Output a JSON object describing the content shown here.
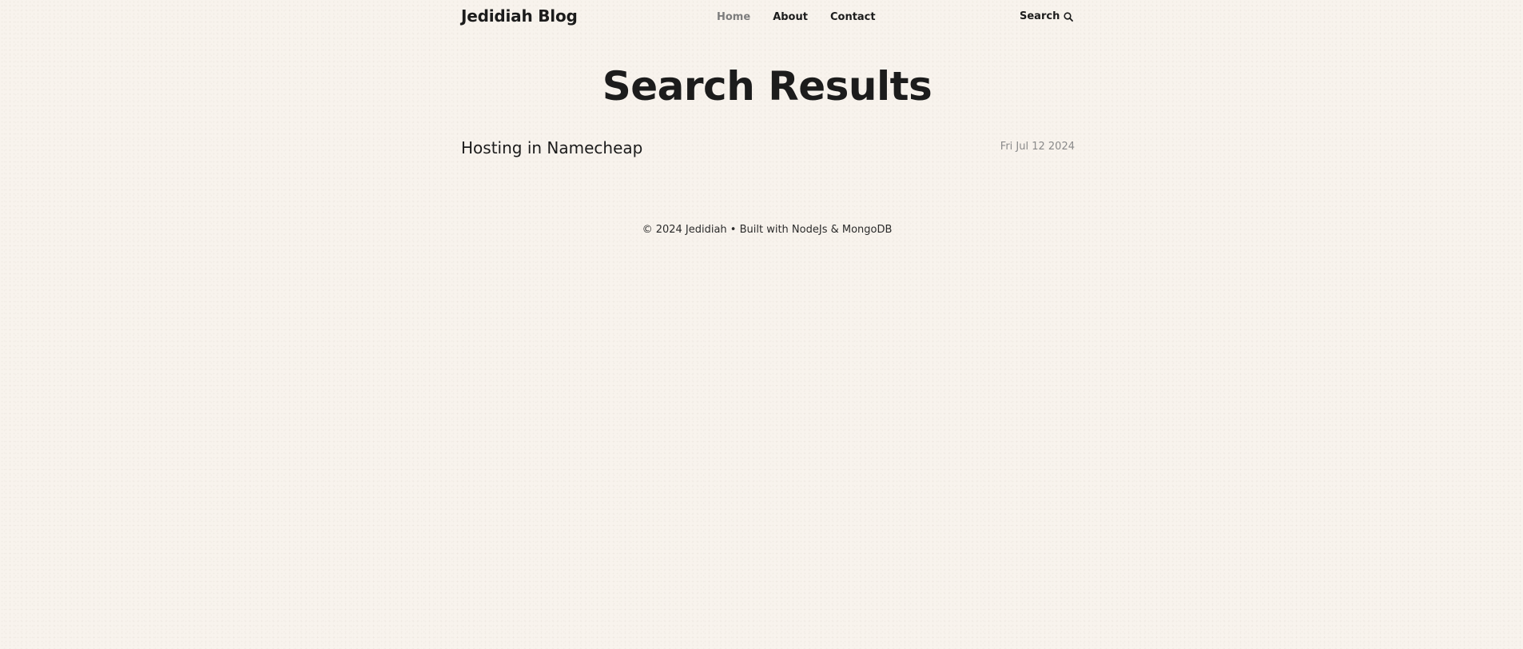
{
  "header": {
    "logo": "Jedidiah Blog",
    "nav": [
      {
        "label": "Home",
        "active": true
      },
      {
        "label": "About",
        "active": false
      },
      {
        "label": "Contact",
        "active": false
      }
    ],
    "search_label": "Search",
    "search_icon": "search-icon"
  },
  "main": {
    "title": "Search Results",
    "results": [
      {
        "title": "Hosting in Namecheap",
        "date": "Fri Jul 12 2024"
      }
    ]
  },
  "footer": {
    "text": "© 2024 Jedidiah • Built with NodeJs & MongoDB"
  },
  "colors": {
    "background": "#f8f3ed",
    "text": "#1c1c1c",
    "active_nav": "#7d7d7d",
    "muted": "#8a8a8a"
  }
}
